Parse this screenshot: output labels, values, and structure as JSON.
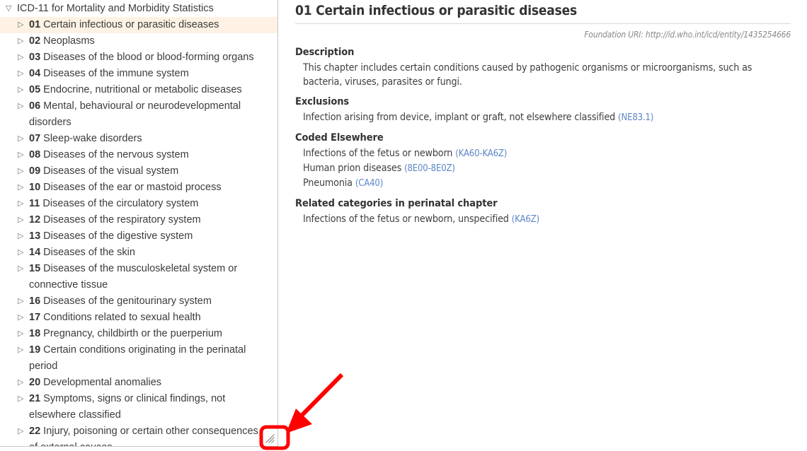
{
  "colors": {
    "selection_highlight": "#fdf2e3",
    "link_blue": "#5c86c6",
    "annotation_red": "#ff0000",
    "panel_border": "#c8c8c8",
    "text": "#3c3c3c"
  },
  "tree": {
    "root": {
      "label": "ICD-11 for Mortality and Morbidity Statistics",
      "twisty": "triangle-down",
      "expanded": true
    },
    "items": [
      {
        "code": "01",
        "label": "Certain infectious or parasitic diseases",
        "twisty": "triangle-right",
        "selected": true
      },
      {
        "code": "02",
        "label": "Neoplasms",
        "twisty": "triangle-right",
        "selected": false
      },
      {
        "code": "03",
        "label": "Diseases of the blood or blood-forming organs",
        "twisty": "triangle-right",
        "selected": false
      },
      {
        "code": "04",
        "label": "Diseases of the immune system",
        "twisty": "triangle-right",
        "selected": false
      },
      {
        "code": "05",
        "label": "Endocrine, nutritional or metabolic diseases",
        "twisty": "triangle-right",
        "selected": false
      },
      {
        "code": "06",
        "label": "Mental, behavioural or neurodevelopmental disorders",
        "twisty": "triangle-right",
        "selected": false
      },
      {
        "code": "07",
        "label": "Sleep-wake disorders",
        "twisty": "triangle-right",
        "selected": false
      },
      {
        "code": "08",
        "label": "Diseases of the nervous system",
        "twisty": "triangle-right",
        "selected": false
      },
      {
        "code": "09",
        "label": "Diseases of the visual system",
        "twisty": "triangle-right",
        "selected": false
      },
      {
        "code": "10",
        "label": "Diseases of the ear or mastoid process",
        "twisty": "triangle-right",
        "selected": false
      },
      {
        "code": "11",
        "label": "Diseases of the circulatory system",
        "twisty": "triangle-right",
        "selected": false
      },
      {
        "code": "12",
        "label": "Diseases of the respiratory system",
        "twisty": "triangle-right",
        "selected": false
      },
      {
        "code": "13",
        "label": "Diseases of the digestive system",
        "twisty": "triangle-right",
        "selected": false
      },
      {
        "code": "14",
        "label": "Diseases of the skin",
        "twisty": "triangle-right",
        "selected": false
      },
      {
        "code": "15",
        "label": "Diseases of the musculoskeletal system or connective tissue",
        "twisty": "triangle-right",
        "selected": false
      },
      {
        "code": "16",
        "label": "Diseases of the genitourinary system",
        "twisty": "triangle-right",
        "selected": false
      },
      {
        "code": "17",
        "label": "Conditions related to sexual health",
        "twisty": "triangle-right",
        "selected": false
      },
      {
        "code": "18",
        "label": "Pregnancy, childbirth or the puerperium",
        "twisty": "triangle-right",
        "selected": false
      },
      {
        "code": "19",
        "label": "Certain conditions originating in the perinatal period",
        "twisty": "triangle-right",
        "selected": false
      },
      {
        "code": "20",
        "label": "Developmental anomalies",
        "twisty": "triangle-right",
        "selected": false
      },
      {
        "code": "21",
        "label": "Symptoms, signs or clinical findings, not elsewhere classified",
        "twisty": "triangle-right",
        "selected": false
      },
      {
        "code": "22",
        "label": "Injury, poisoning or certain other consequences of external causes",
        "twisty": "triangle-right",
        "selected": false
      }
    ],
    "resize_grip": "resize-grip-icon"
  },
  "detail": {
    "title": "01 Certain infectious or parasitic diseases",
    "foundation_uri": "Foundation URI: http://id.who.int/icd/entity/1435254666",
    "sections": {
      "description": {
        "title": "Description",
        "text": "This chapter includes certain conditions caused by pathogenic organisms or microorganisms, such as bacteria, viruses, parasites or fungi."
      },
      "exclusions": {
        "title": "Exclusions",
        "entries": [
          {
            "label": "Infection arising from device, implant or graft, not elsewhere classified",
            "code": "(NE83.1)"
          }
        ]
      },
      "coded_elsewhere": {
        "title": "Coded Elsewhere",
        "entries": [
          {
            "label": "Infections of the fetus or newborn",
            "code": "(KA60-KA6Z)"
          },
          {
            "label": "Human prion diseases",
            "code": "(8E00-8E0Z)"
          },
          {
            "label": "Pneumonia",
            "code": "(CA40)"
          }
        ]
      },
      "related_perinatal": {
        "title": "Related categories in perinatal chapter",
        "entries": [
          {
            "label": "Infections of the fetus or newborn, unspecified",
            "code": "(KA6Z)"
          }
        ]
      }
    }
  },
  "annotation": {
    "arrow": "red-arrow-pointing-to-resize-grip",
    "highlight_box": "red-rounded-rect-around-resize-grip"
  }
}
